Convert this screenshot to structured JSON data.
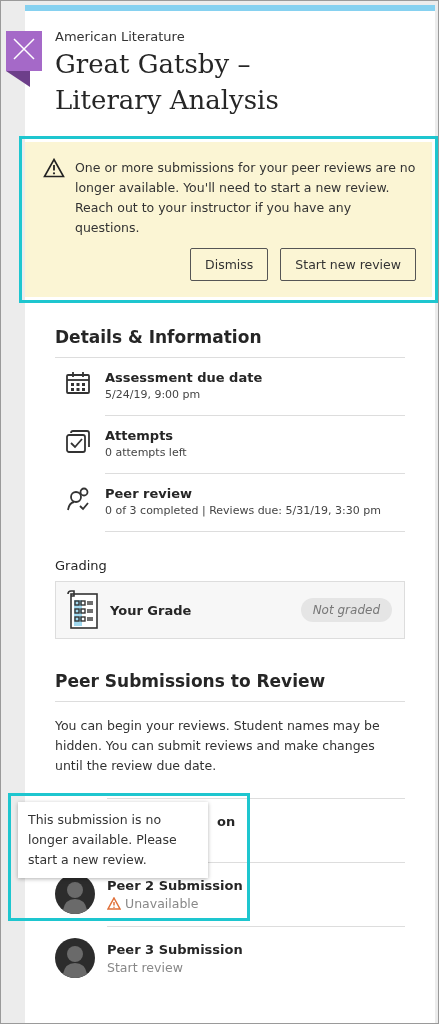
{
  "course": "American Literature",
  "title": "Great Gatsby – Literary Analysis",
  "alert": {
    "message": "One or more submissions for your peer reviews are no longer available. You'll need to start a new review. Reach out to your instructor if you have any questions.",
    "buttons": [
      "Dismiss",
      "Start new review"
    ]
  },
  "details": {
    "heading": "Details & Information",
    "items": [
      {
        "kind": "calendar",
        "label": "Assessment due date",
        "value": "5/24/19, 9:00 pm"
      },
      {
        "kind": "attempts",
        "label": "Attempts",
        "value": "0 attempts left"
      },
      {
        "kind": "peer",
        "label": "Peer review",
        "value": "0 of 3 completed | Reviews due: 5/31/19, 3:30 pm"
      }
    ]
  },
  "grading": {
    "heading": "Grading",
    "label": "Your Grade",
    "status": "Not graded"
  },
  "peer_submissions": {
    "heading": "Peer Submissions to Review",
    "description": "You can begin your reviews. Student names may be hidden. You can submit reviews and make changes until the review due date.",
    "items": [
      {
        "kind": "covered",
        "title": "on"
      },
      {
        "kind": "unavailable",
        "title": "Peer 2 Submission",
        "status": "Unavailable"
      },
      {
        "kind": "available",
        "title": "Peer 3 Submission",
        "status": "Start review"
      }
    ]
  },
  "tooltip": "This submission is no longer available. Please start a new review."
}
